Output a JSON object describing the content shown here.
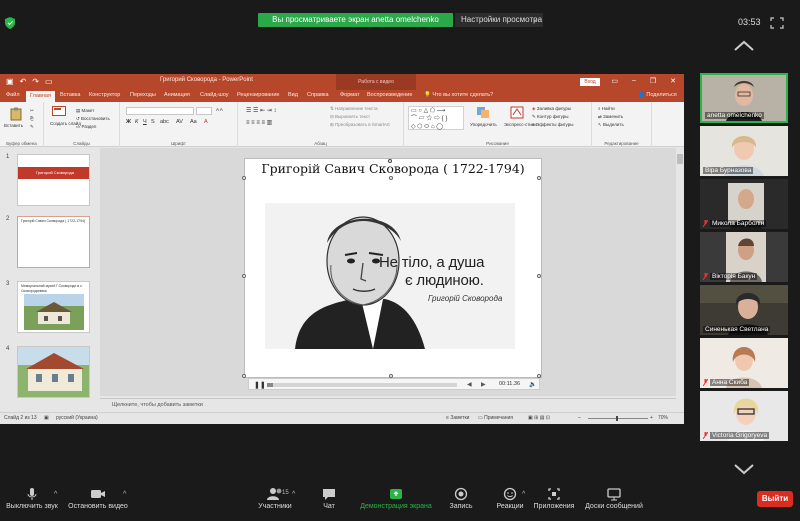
{
  "zoom": {
    "share_banner": "Вы просматриваете экран anetta omelchenko",
    "view_options": "Настройки просмотра",
    "clock": "03:53",
    "leave": "Выйти",
    "toolbar": {
      "mute": "Выключить звук",
      "stop_video": "Остановить видео",
      "participants": "Участники",
      "participants_count": "15",
      "chat": "Чат",
      "share": "Демонстрация экрана",
      "record": "Запись",
      "reactions": "Реакции",
      "apps": "Приложения",
      "whiteboards": "Доски сообщений"
    },
    "participants": [
      {
        "name": "anetta omelchenko"
      },
      {
        "name": "Віра Бурназова"
      },
      {
        "name": "Микола Барболін"
      },
      {
        "name": "Вікторія Бакун"
      },
      {
        "name": "Синенькая Светлана"
      },
      {
        "name": "Анна Скиба"
      },
      {
        "name": "Victoria Grigoryeva"
      }
    ]
  },
  "powerpoint": {
    "doc_title": "Григорий Сковорода  -  PowerPoint",
    "context_tab": "Работа с видео",
    "login": "Вход",
    "tabs": [
      "Файл",
      "Главная",
      "Вставка",
      "Конструктор",
      "Переходы",
      "Анимация",
      "Слайд-шоу",
      "Рецензирование",
      "Вид",
      "Справка",
      "Формат",
      "Воспроизведение"
    ],
    "tell_me": "Что вы хотите сделать?",
    "share_label": "Поделиться",
    "ribbon": {
      "paste": "Вставить",
      "clipboard": "Буфер обмена",
      "new_slide": "Создать слайд",
      "layout": "Макет",
      "reset": "Восстановить",
      "section": "Раздел",
      "slides": "Слайды",
      "font": "Шрифт",
      "paragraph": "Абзац",
      "text_dir": "Направление текста",
      "align_text": "Выровнять текст",
      "smartart": "Преобразовать в SmartArt",
      "arrange": "Упорядочить",
      "quick_styles": "Экспресс-стили",
      "drawing": "Рисование",
      "fill": "Заливка фигуры",
      "outline": "Контур фигуры",
      "effects": "Эффекты фигуры",
      "find": "Найти",
      "replace": "Заменить",
      "select": "Выделить",
      "editing": "Редактирование"
    },
    "thumbs": [
      {
        "num": "1",
        "text": "Григорий Сковорода"
      },
      {
        "num": "2",
        "text": "Григорій Савич Сковорода ( 1722-1794)"
      },
      {
        "num": "3",
        "text": "Меморіальний музей Г.Сковороди в с. Сковородинівка"
      },
      {
        "num": "4",
        "text": ""
      }
    ],
    "slide": {
      "title": "Григорій Савич Сковорода ( 1722-1794)",
      "quote_line1": "Не тіло, а душа",
      "quote_line2": "є людиною.",
      "quote_author": "Григорій Сковорода"
    },
    "media_time": "00:11.36",
    "notes_placeholder": "Щелкните, чтобы добавить заметки",
    "status": {
      "slide_info": "Слайд 2 из 13",
      "language": "русский (Украина)",
      "notes": "Заметки",
      "comments": "Примечания",
      "zoom": "70%"
    }
  }
}
